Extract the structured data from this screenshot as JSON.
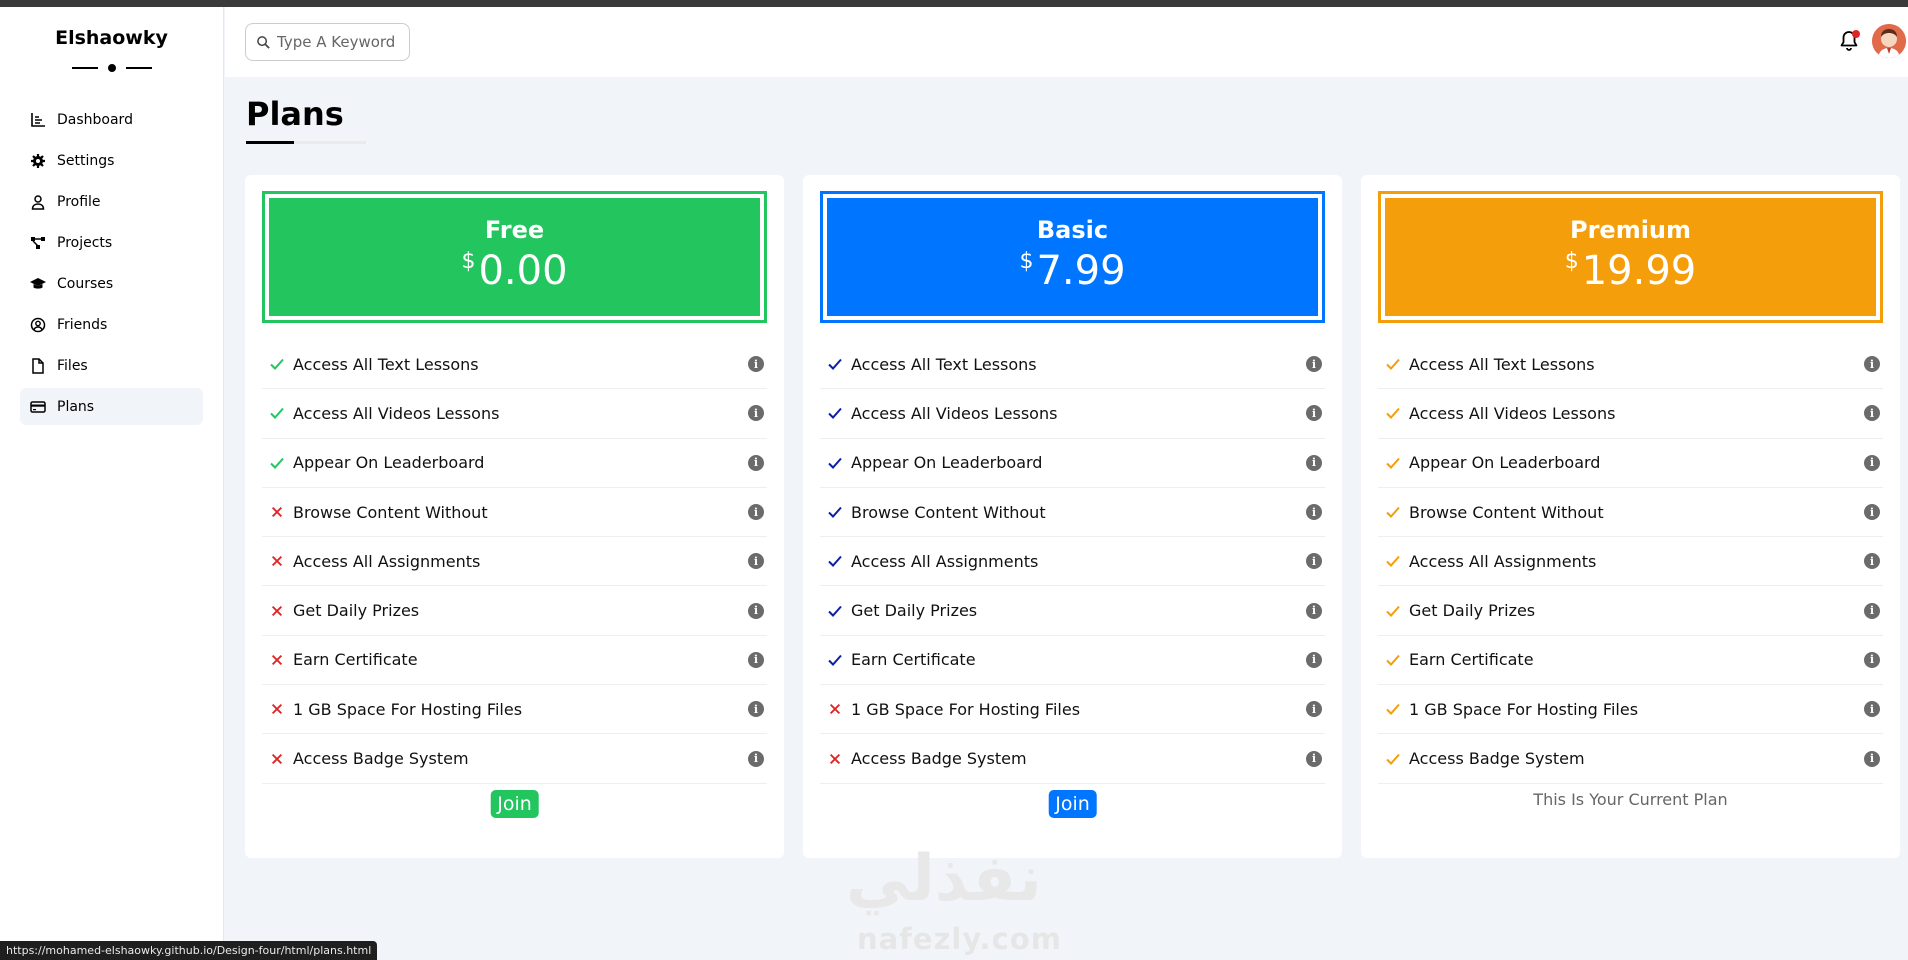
{
  "brand": {
    "name": "Elshaowky"
  },
  "sidebar": {
    "items": [
      {
        "label": "Dashboard",
        "icon": "chart-icon"
      },
      {
        "label": "Settings",
        "icon": "gear-icon"
      },
      {
        "label": "Profile",
        "icon": "user-icon"
      },
      {
        "label": "Projects",
        "icon": "diagram-icon"
      },
      {
        "label": "Courses",
        "icon": "graduation-cap-icon"
      },
      {
        "label": "Friends",
        "icon": "user-circle-icon"
      },
      {
        "label": "Files",
        "icon": "file-icon"
      },
      {
        "label": "Plans",
        "icon": "credit-card-icon",
        "active": true
      }
    ]
  },
  "header": {
    "search_placeholder": "Type A Keyword",
    "notification_dot": true
  },
  "page": {
    "title": "Plans"
  },
  "plans": [
    {
      "name": "Free",
      "currency": "$",
      "price": "0.00",
      "color": "#22c55e",
      "features": [
        {
          "label": "Access All Text Lessons",
          "included": true
        },
        {
          "label": "Access All Videos Lessons",
          "included": true
        },
        {
          "label": "Appear On Leaderboard",
          "included": true
        },
        {
          "label": "Browse Content Without",
          "included": false
        },
        {
          "label": "Access All Assignments",
          "included": false
        },
        {
          "label": "Get Daily Prizes",
          "included": false
        },
        {
          "label": "Earn Certificate",
          "included": false
        },
        {
          "label": "1 GB Space For Hosting Files",
          "included": false
        },
        {
          "label": "Access Badge System",
          "included": false
        }
      ],
      "action": "Join"
    },
    {
      "name": "Basic",
      "currency": "$",
      "price": "7.99",
      "color": "#0075ff",
      "features": [
        {
          "label": "Access All Text Lessons",
          "included": true
        },
        {
          "label": "Access All Videos Lessons",
          "included": true
        },
        {
          "label": "Appear On Leaderboard",
          "included": true
        },
        {
          "label": "Browse Content Without",
          "included": true
        },
        {
          "label": "Access All Assignments",
          "included": true
        },
        {
          "label": "Get Daily Prizes",
          "included": true
        },
        {
          "label": "Earn Certificate",
          "included": true
        },
        {
          "label": "1 GB Space For Hosting Files",
          "included": false
        },
        {
          "label": "Access Badge System",
          "included": false
        }
      ],
      "action": "Join"
    },
    {
      "name": "Premium",
      "currency": "$",
      "price": "19.99",
      "color": "#f59e0b",
      "features": [
        {
          "label": "Access All Text Lessons",
          "included": true
        },
        {
          "label": "Access All Videos Lessons",
          "included": true
        },
        {
          "label": "Appear On Leaderboard",
          "included": true
        },
        {
          "label": "Browse Content Without",
          "included": true
        },
        {
          "label": "Access All Assignments",
          "included": true
        },
        {
          "label": "Get Daily Prizes",
          "included": true
        },
        {
          "label": "Earn Certificate",
          "included": true
        },
        {
          "label": "1 GB Space For Hosting Files",
          "included": true
        },
        {
          "label": "Access Badge System",
          "included": true
        }
      ],
      "current_text": "This Is Your Current Plan"
    }
  ],
  "colors": {
    "cross": "#e02424",
    "check_free": "#22c55e",
    "check_basic": "#0b1fa8",
    "check_premium": "#f59e0b"
  },
  "watermark": {
    "arabic": "نفذلي",
    "latin": "nafezly.com"
  },
  "status_bar": {
    "url": "https://mohamed-elshaowky.github.io/Design-four/html/plans.html"
  }
}
